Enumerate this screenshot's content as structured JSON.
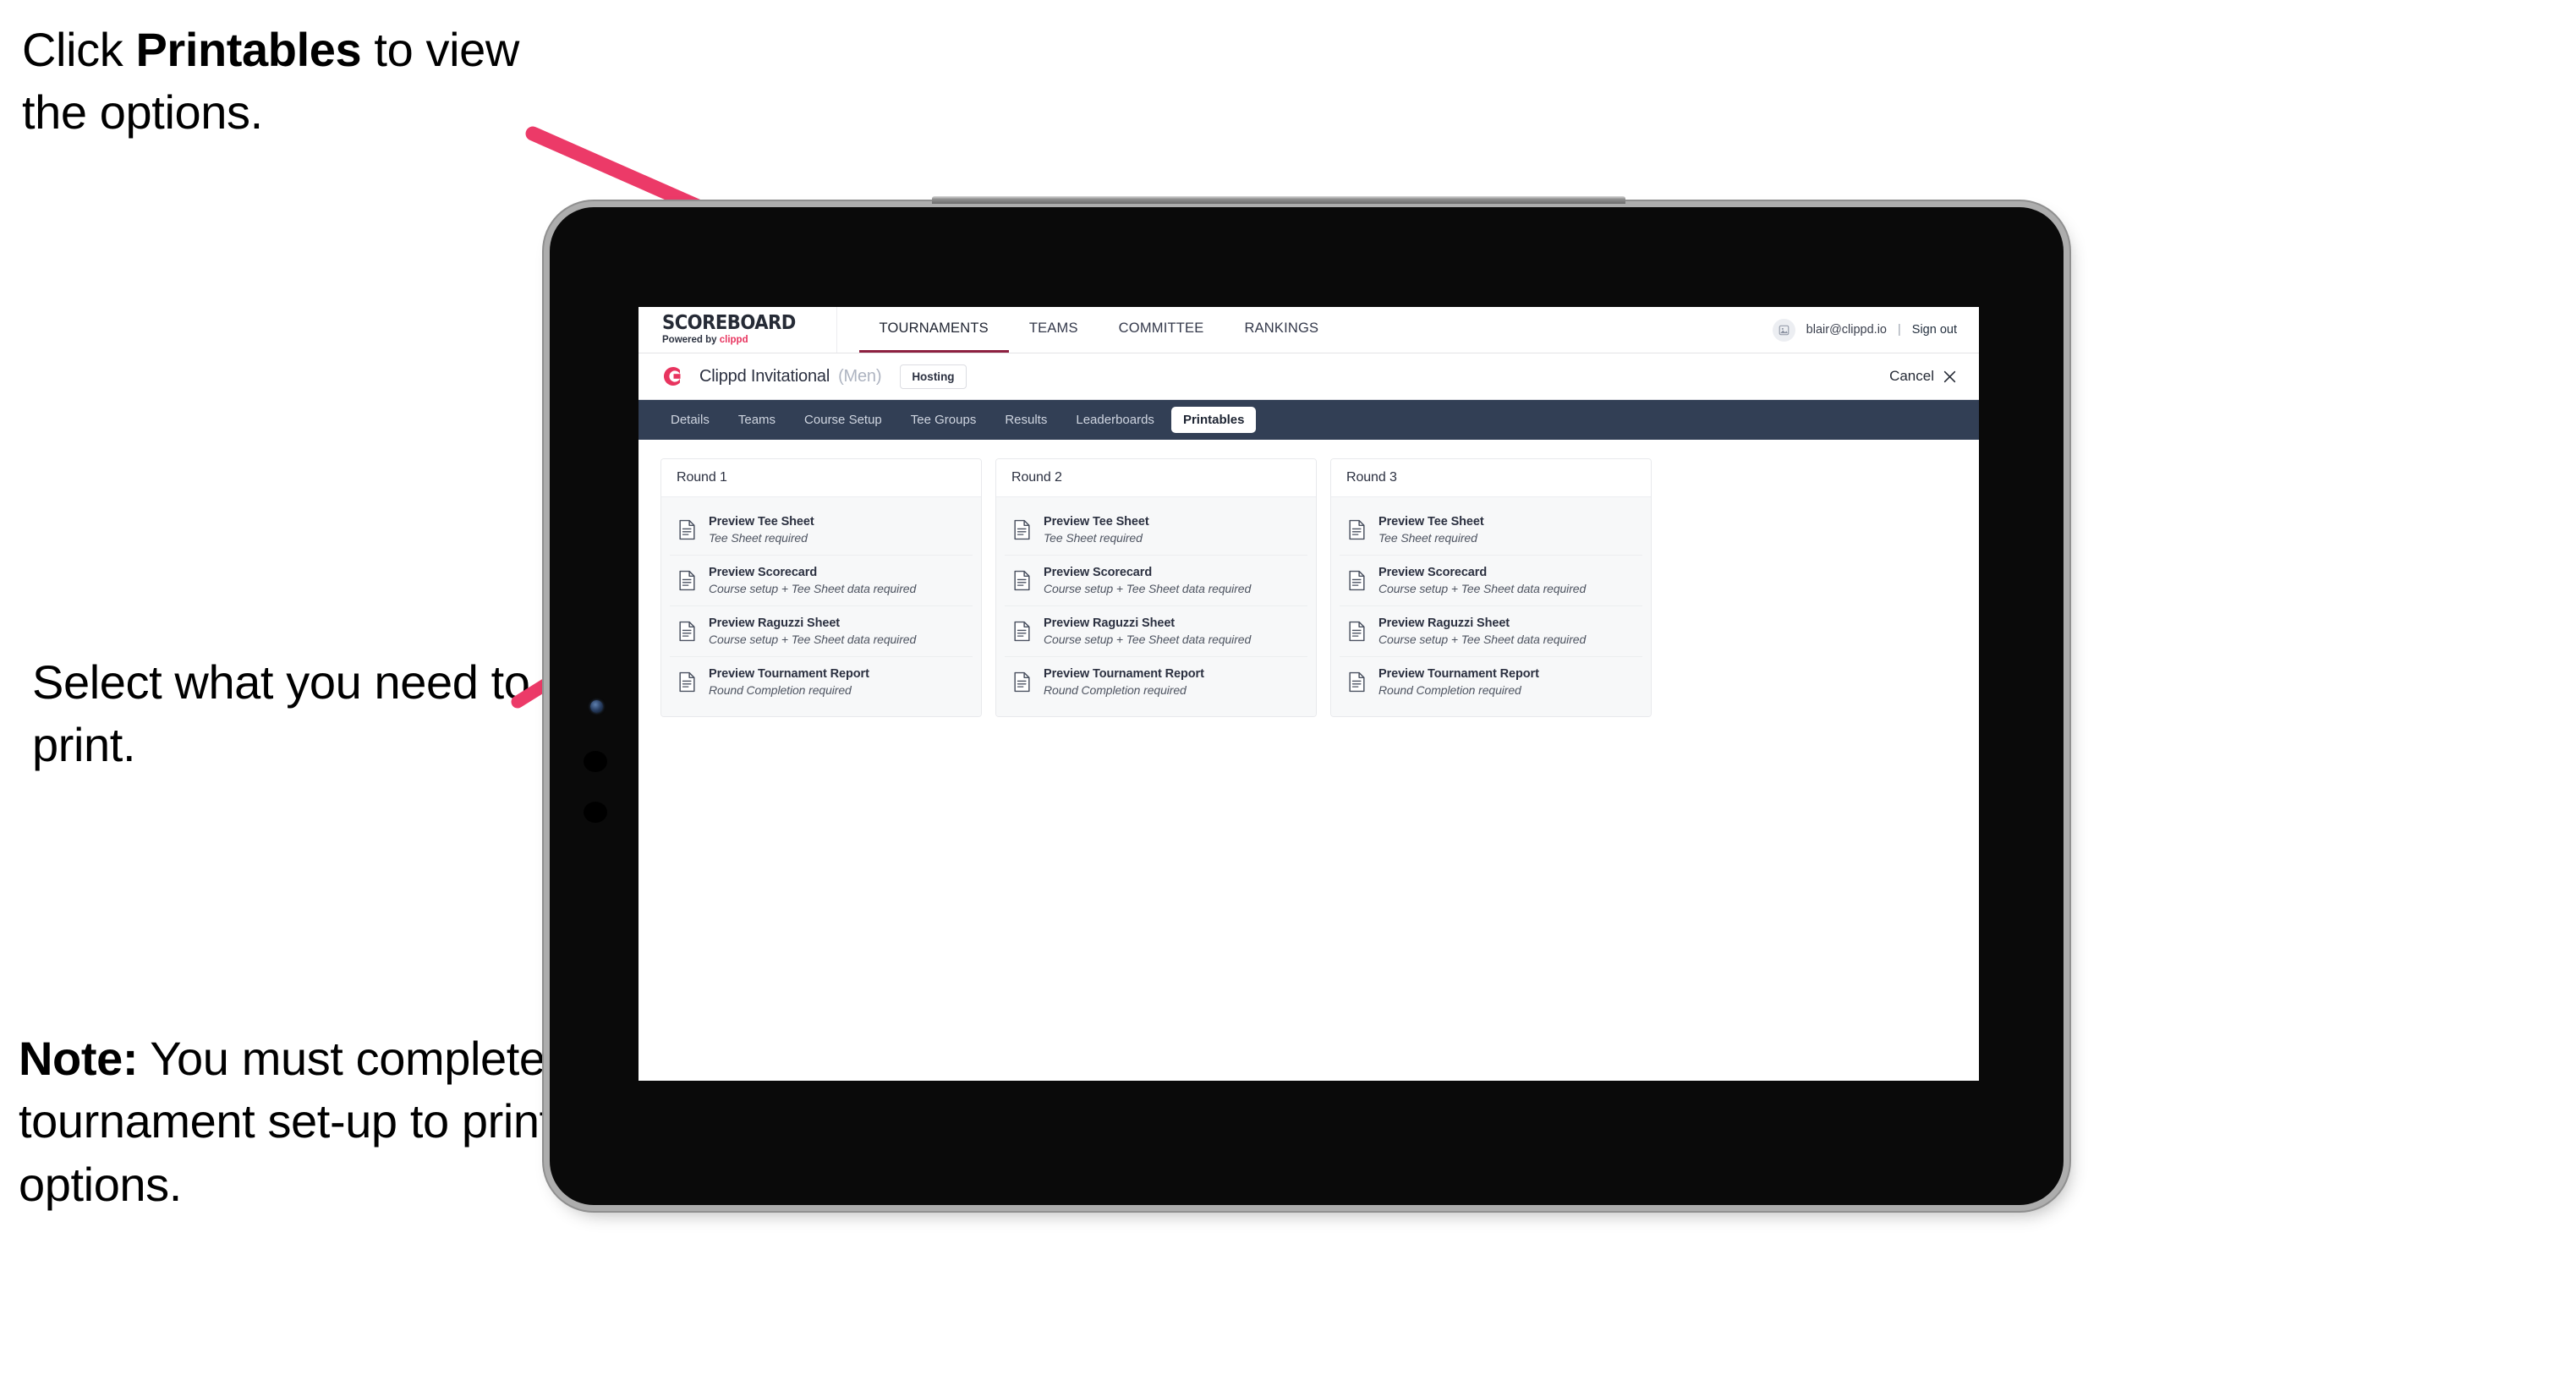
{
  "annotations": [
    {
      "id": "ann-1",
      "prefix": "Click ",
      "bold": "Printables",
      "suffix": " to view the options."
    },
    {
      "id": "ann-2",
      "prefix": "",
      "bold": "",
      "suffix": "Select what you need to print."
    },
    {
      "id": "ann-3",
      "prefix": "",
      "bold": "Note:",
      "suffix": " You must complete the tournament set-up to print all the options."
    }
  ],
  "colors": {
    "arrow_pink": "#ec3a68",
    "brand_accent": "#e8345f",
    "subnav_bg": "#323f55",
    "active_underline": "#8d2040",
    "tournament_logo": "#e8345f"
  },
  "app": {
    "brand": {
      "title": "SCOREBOARD",
      "powered_prefix": "Powered by ",
      "powered_accent": "clippd"
    },
    "main_nav": [
      {
        "label": "TOURNAMENTS",
        "active": true
      },
      {
        "label": "TEAMS",
        "active": false
      },
      {
        "label": "COMMITTEE",
        "active": false
      },
      {
        "label": "RANKINGS",
        "active": false
      }
    ],
    "user": {
      "email": "blair@clippd.io",
      "separator": "|",
      "sign_out": "Sign out",
      "avatar_icon": "user-avatar-icon"
    },
    "tournament": {
      "logo_icon": "clippd-c-logo-icon",
      "name": "Clippd Invitational",
      "gender": "(Men)",
      "badge": "Hosting",
      "cancel_label": "Cancel",
      "cancel_icon": "close-icon"
    },
    "sub_nav": [
      {
        "label": "Details",
        "active": false
      },
      {
        "label": "Teams",
        "active": false
      },
      {
        "label": "Course Setup",
        "active": false
      },
      {
        "label": "Tee Groups",
        "active": false
      },
      {
        "label": "Results",
        "active": false
      },
      {
        "label": "Leaderboards",
        "active": false
      },
      {
        "label": "Printables",
        "active": true
      }
    ],
    "rounds": [
      {
        "header": "Round 1",
        "items": [
          {
            "title": "Preview Tee Sheet",
            "requirement": "Tee Sheet required"
          },
          {
            "title": "Preview Scorecard",
            "requirement": "Course setup + Tee Sheet data required"
          },
          {
            "title": "Preview Raguzzi Sheet",
            "requirement": "Course setup + Tee Sheet data required"
          },
          {
            "title": "Preview Tournament Report",
            "requirement": "Round Completion required"
          }
        ]
      },
      {
        "header": "Round 2",
        "items": [
          {
            "title": "Preview Tee Sheet",
            "requirement": "Tee Sheet required"
          },
          {
            "title": "Preview Scorecard",
            "requirement": "Course setup + Tee Sheet data required"
          },
          {
            "title": "Preview Raguzzi Sheet",
            "requirement": "Course setup + Tee Sheet data required"
          },
          {
            "title": "Preview Tournament Report",
            "requirement": "Round Completion required"
          }
        ]
      },
      {
        "header": "Round 3",
        "items": [
          {
            "title": "Preview Tee Sheet",
            "requirement": "Tee Sheet required"
          },
          {
            "title": "Preview Scorecard",
            "requirement": "Course setup + Tee Sheet data required"
          },
          {
            "title": "Preview Raguzzi Sheet",
            "requirement": "Course setup + Tee Sheet data required"
          },
          {
            "title": "Preview Tournament Report",
            "requirement": "Round Completion required"
          }
        ]
      }
    ]
  }
}
